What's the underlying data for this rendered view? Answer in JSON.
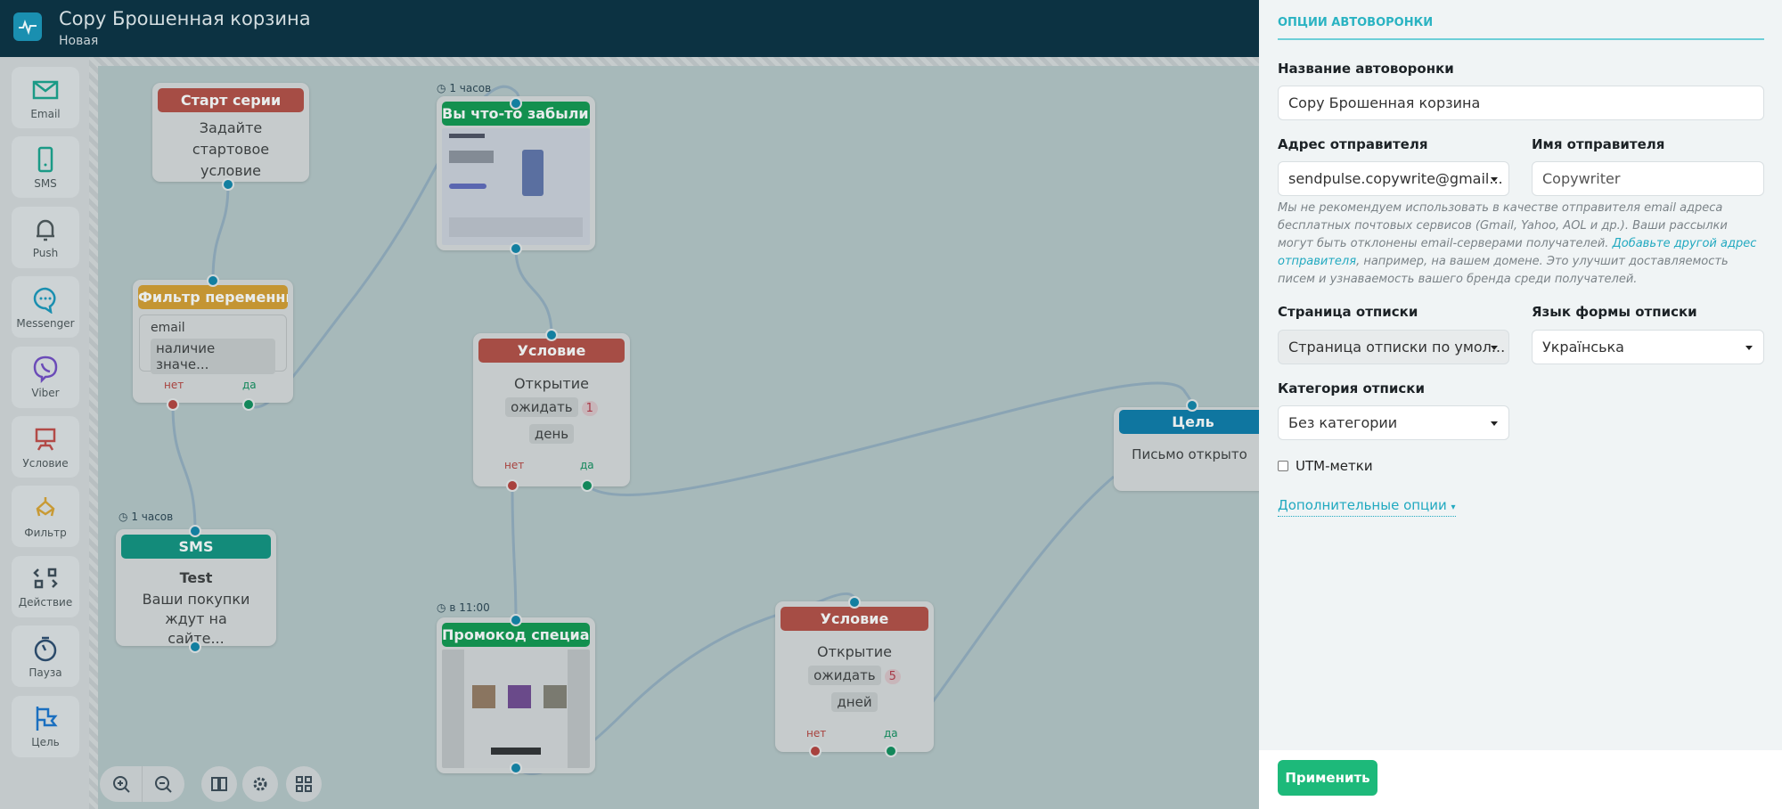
{
  "header": {
    "title": "Copy Брошенная корзина",
    "status": "Новая",
    "logo_icon": "pulse-icon"
  },
  "toolbox": [
    {
      "label": "Email",
      "icon": "envelope-icon",
      "color": "#1a9a86"
    },
    {
      "label": "SMS",
      "icon": "phone-icon",
      "color": "#1a9a86"
    },
    {
      "label": "Push",
      "icon": "bell-icon",
      "color": "#4a5558"
    },
    {
      "label": "Messenger",
      "icon": "chat-icon",
      "color": "#1a8fb0"
    },
    {
      "label": "Viber",
      "icon": "viber-icon",
      "color": "#6b4bb8"
    },
    {
      "label": "Условие",
      "icon": "condition-icon",
      "color": "#b24a47"
    },
    {
      "label": "Фильтр",
      "icon": "filter-icon",
      "color": "#c89a35"
    },
    {
      "label": "Действие",
      "icon": "action-icon",
      "color": "#3a4a55"
    },
    {
      "label": "Пауза",
      "icon": "timer-icon",
      "color": "#2b4a6a"
    },
    {
      "label": "Цель",
      "icon": "flag-icon",
      "color": "#1a6fc0"
    }
  ],
  "nodes": {
    "start": {
      "title": "Старт серии",
      "text": "Задайте стартовое условие"
    },
    "filter": {
      "title": "Фильтр переменных",
      "field": "email",
      "condition": "наличие значе...",
      "no": "нет",
      "yes": "да"
    },
    "email1": {
      "timer": "1 часов",
      "title": "Вы что-то забыли!"
    },
    "cond1": {
      "title": "Условие",
      "event": "Открытие",
      "wait": "ожидать",
      "count": "1",
      "unit": "день",
      "no": "нет",
      "yes": "да"
    },
    "sms": {
      "timer": "1 часов",
      "title": "SMS",
      "name": "Test",
      "text": "Ваши покупки ждут на сайте..."
    },
    "email2": {
      "timer": "в 11:00",
      "title": "Промокод специа..."
    },
    "cond2": {
      "title": "Условие",
      "event": "Открытие",
      "wait": "ожидать",
      "count": "5",
      "unit": "дней",
      "no": "нет",
      "yes": "да"
    },
    "goal": {
      "title": "Цель",
      "text": "Письмо открыто"
    }
  },
  "colors": {
    "start": "#a64d45",
    "filter": "#c49533",
    "email": "#13904f",
    "condition": "#a64d45",
    "sms": "#138b7a",
    "goal": "#0f76a0"
  },
  "canvas_controls": [
    "zoom-in-icon",
    "zoom-out-icon",
    "book-icon",
    "gear-icon",
    "qr-icon"
  ],
  "panel": {
    "title": "ОПЦИИ АВТОВОРОНКИ",
    "name_label": "Название автоворонки",
    "name_value": "Copy Брошенная корзина",
    "sender_address_label": "Адрес отправителя",
    "sender_address_value": "sendpulse.copywrite@gmail...",
    "sender_name_label": "Имя отправителя",
    "sender_name_value": "Copywriter",
    "note_text": "Мы не рекомендуем использовать в качестве отправителя email адреса бесплатных почтовых сервисов (Gmail, Yahoo, AOL и др.). Ваши рассылки могут быть отклонены email-серверами получателей. ",
    "note_link": "Добавьте другой адрес отправителя",
    "note_tail": ", например, на вашем домене. Это улучшит доставляемость писем и узнаваемость вашего бренда среди получателей.",
    "unsub_page_label": "Страница отписки",
    "unsub_page_value": "Страница отписки по умол...",
    "unsub_lang_label": "Язык формы отписки",
    "unsub_lang_value": "Українська",
    "unsub_cat_label": "Категория отписки",
    "unsub_cat_value": "Без категории",
    "utm_label": "UTM-метки",
    "utm_checked": false,
    "more_label": "Дополнительные опции",
    "apply_label": "Применить"
  }
}
